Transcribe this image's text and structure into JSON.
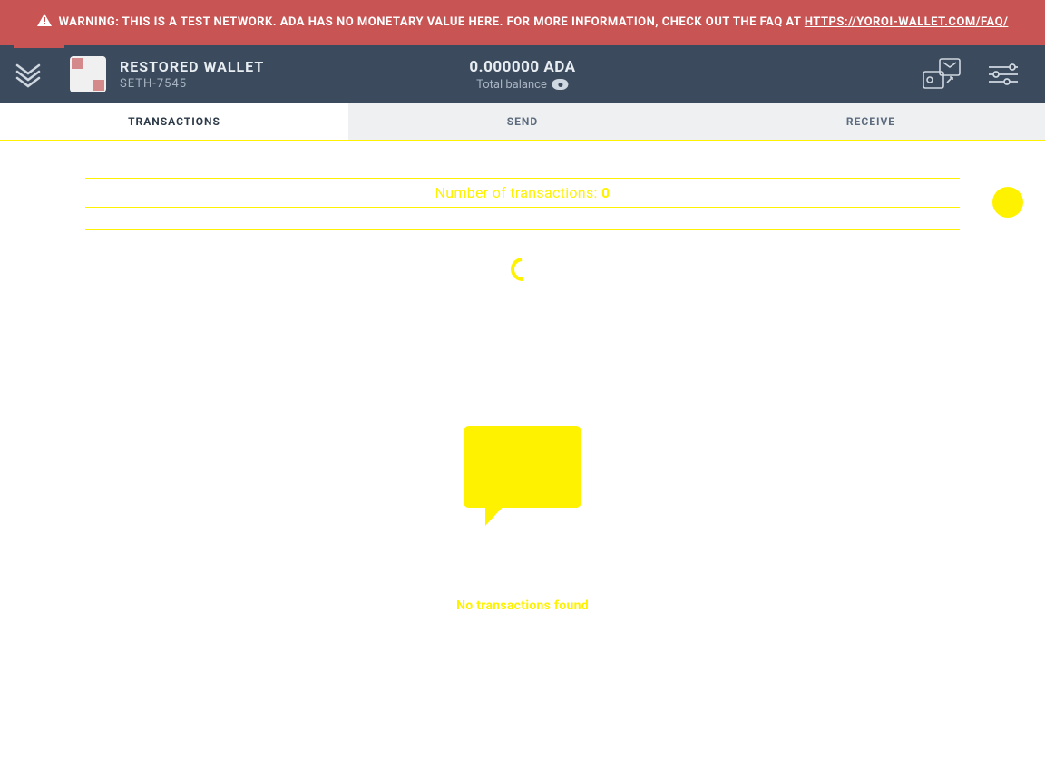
{
  "warning": {
    "text_prefix": "WARNING: THIS IS A TEST NETWORK. ADA HAS NO MONETARY VALUE HERE. FOR MORE INFORMATION, CHECK OUT THE FAQ AT ",
    "link_text": "HTTPS://YOROI-WALLET.COM/FAQ/"
  },
  "wallet": {
    "name": "RESTORED WALLET",
    "subtitle": "SETH-7545"
  },
  "balance": {
    "amount": "0.000000 ADA",
    "label": "Total balance"
  },
  "tabs": {
    "transactions": "TRANSACTIONS",
    "send": "SEND",
    "receive": "RECEIVE"
  },
  "transactions": {
    "count_label": "Number of transactions: ",
    "count_value": "0",
    "empty_message": "No transactions found"
  },
  "colors": {
    "accent": "#fff200",
    "header_bg": "#3b4a5c",
    "warning_bg": "#c85454"
  },
  "icons": {
    "logo": "yoroi-logo-icon",
    "warning": "warning-triangle-icon",
    "eye": "eye-icon",
    "transfer": "wallet-transfer-icon",
    "settings": "settings-sliders-icon",
    "empty": "speech-bubble-icon",
    "fab": "export-icon"
  }
}
